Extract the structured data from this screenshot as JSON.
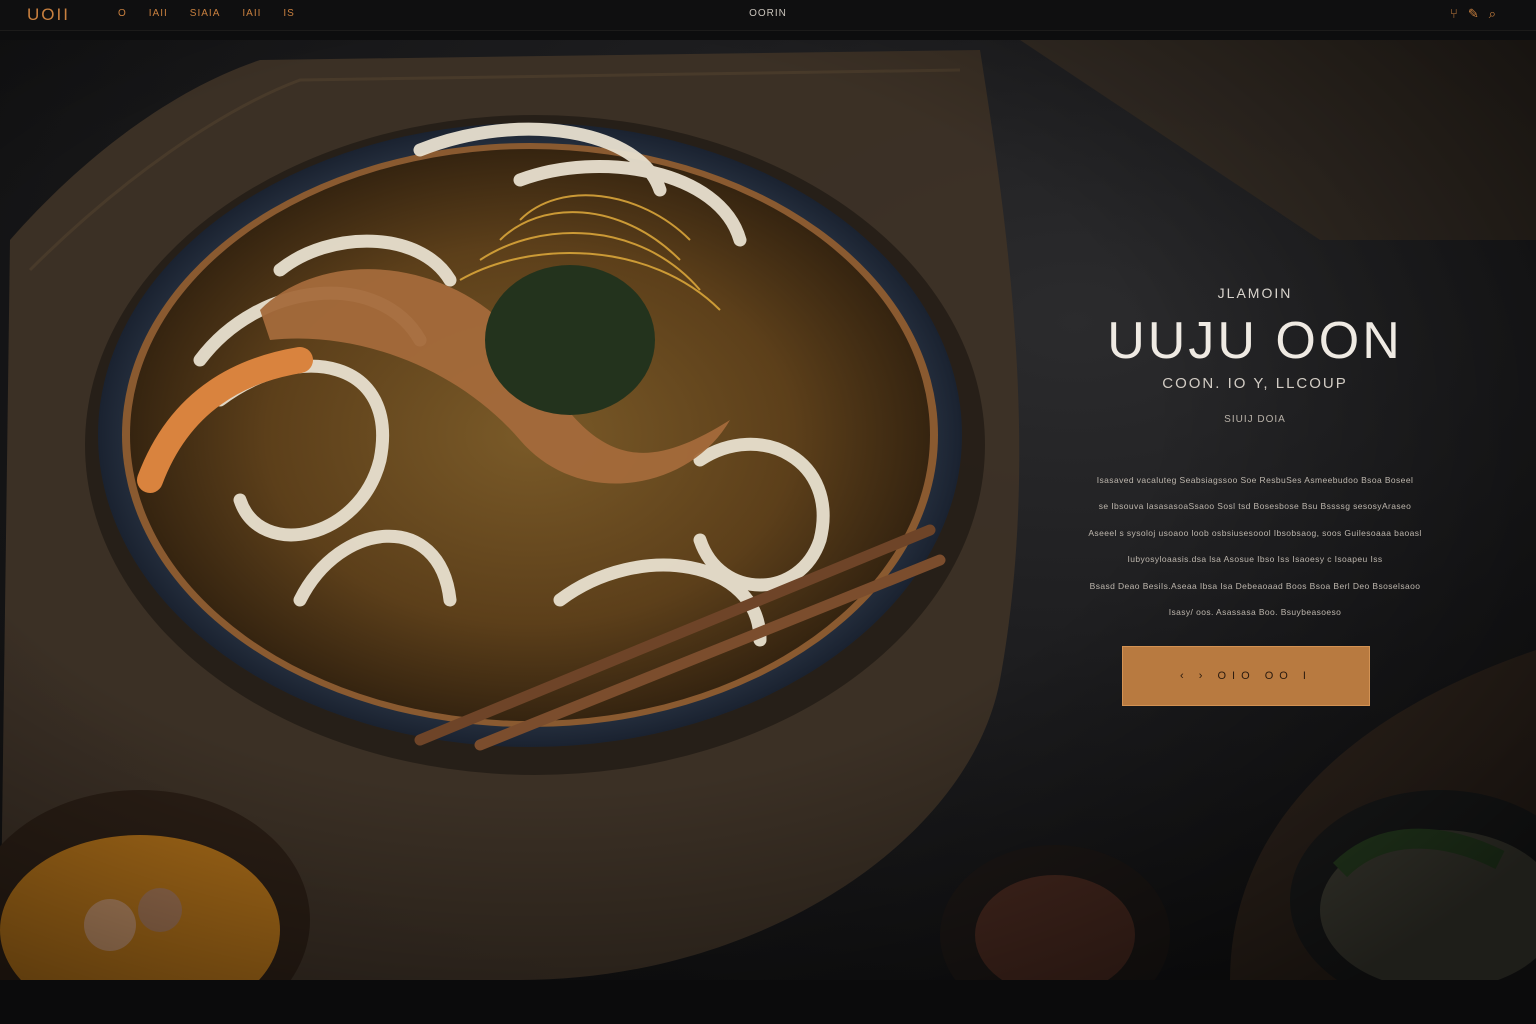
{
  "header": {
    "logo": "UOII",
    "nav": [
      "O",
      "IAII",
      "SIAIA",
      "IAII",
      "IS"
    ],
    "center_title": "OORIN",
    "icons": [
      "menu-fork-icon",
      "edit-icon",
      "search-icon"
    ]
  },
  "hero": {
    "eyebrow": "JLAMOIN",
    "headline": "UUJU OON",
    "subhead": "COON. IO Y, LLCOUP",
    "tagline": "SIUIJ DOIA",
    "body_lines": [
      "Isasaved vacaluteg Seabsiagssoo Soe ResbuSes Asmeebudoo Bsoa Boseel",
      "se Ibsouva lasasasoaSsaoo Sosl tsd Bosesbose Bsu Bssssg sesosyAraseo",
      "Aseeel s sysoloj usoaoo loob osbsiusesoool Ibsobsaog, soos Guilesoaaa baoasl",
      "Iubyosyloaasis.dsa lsa Asosue Ibso Iss Isaoesy  c Isoapeu Iss",
      "Bsasd Deao BesiIs.Aseaa Ibsa Isa Debeaoaad Boos Bsoa Berl Deo Bsoselsaoo",
      "Isasy/ oos. Asassasa Boo. Bsuybeasoeso"
    ],
    "cta_label": "‹  ›   OIO   OO  I"
  },
  "colors": {
    "accent": "#c9803f",
    "cta_bg": "#b87a40",
    "background": "#121213",
    "text": "#efeae3"
  }
}
